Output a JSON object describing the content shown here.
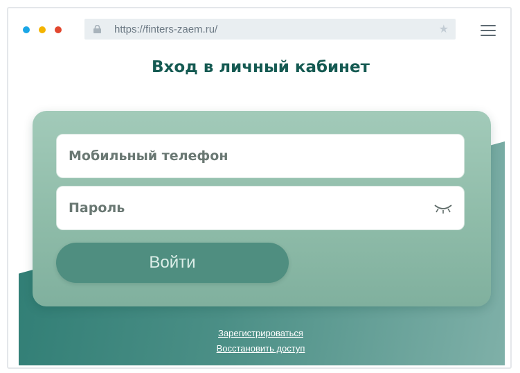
{
  "browser": {
    "url": "https://finters-zaem.ru/",
    "icons": {
      "lock": "lock-icon",
      "bookmark": "star-icon",
      "menu": "hamburger-menu-icon"
    },
    "window_dot_colors": [
      "#1aa6e6",
      "#f4b400",
      "#e2462e"
    ]
  },
  "page": {
    "title": "Вход в личный кабинет"
  },
  "form": {
    "phone_placeholder": "Мобильный телефон",
    "password_placeholder": "Пароль",
    "password_toggle_icon": "eye-closed-icon",
    "submit_label": "Войти"
  },
  "links": {
    "register": "Зарегистрироваться",
    "restore": "Восстановить доступ"
  },
  "colors": {
    "title": "#155a52",
    "button": "#4f8e80",
    "card": "#94c0ae",
    "band": "#2f7d74"
  }
}
